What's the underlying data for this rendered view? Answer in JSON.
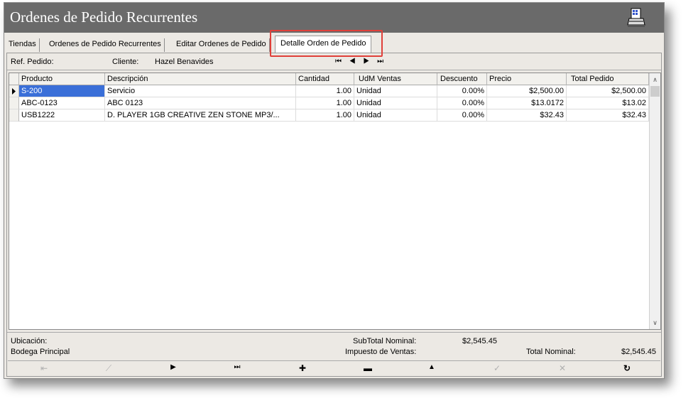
{
  "window": {
    "title": "Ordenes de Pedido Recurrentes"
  },
  "tabs": [
    {
      "label": "Tiendas"
    },
    {
      "label": "Ordenes de Pedido Recurrentes"
    },
    {
      "label": "Editar Ordenes de Pedido"
    },
    {
      "label": "Detalle Orden de Pedido"
    }
  ],
  "header": {
    "ref_label": "Ref. Pedido:",
    "client_label": "Cliente:",
    "client_value": "Hazel Benavides",
    "nav": "⏮ ◀ ▶ ⏭"
  },
  "grid": {
    "columns": [
      "Producto",
      "Descripción",
      "Cantidad",
      "UdM Ventas",
      "Descuento",
      "Precio",
      "Total Pedido"
    ],
    "rows": [
      {
        "producto": "S-200",
        "descripcion": "Servicio",
        "cantidad": "1.00",
        "udm": "Unidad",
        "descuento": "0.00%",
        "precio": "$2,500.00",
        "total": "$2,500.00"
      },
      {
        "producto": "ABC-0123",
        "descripcion": "ABC 0123",
        "cantidad": "1.00",
        "udm": "Unidad",
        "descuento": "0.00%",
        "precio": "$13.0172",
        "total": "$13.02"
      },
      {
        "producto": "USB1222",
        "descripcion": "D. PLAYER 1GB CREATIVE ZEN STONE MP3/...",
        "cantidad": "1.00",
        "udm": "Unidad",
        "descuento": "0.00%",
        "precio": "$32.43",
        "total": "$32.43"
      }
    ]
  },
  "footer": {
    "location_label": "Ubicación:",
    "location_value": "Bodega Principal",
    "subtotal_label": "SubTotal Nominal:",
    "subtotal_value": "$2,545.45",
    "tax_label": "Impuesto de Ventas:",
    "total_label": "Total Nominal:",
    "total_value": "$2,545.45"
  },
  "toolbar": {
    "first": "⇤",
    "prev": "⟋",
    "next": "▶",
    "last": "⏭",
    "add": "✚",
    "remove": "▬",
    "up": "▲",
    "confirm": "✓",
    "cancel": "✕",
    "refresh": "↻"
  },
  "colors": {
    "titlebar": "#6a6a6a",
    "selection": "#3a6fd8",
    "highlight": "#e0403a"
  }
}
